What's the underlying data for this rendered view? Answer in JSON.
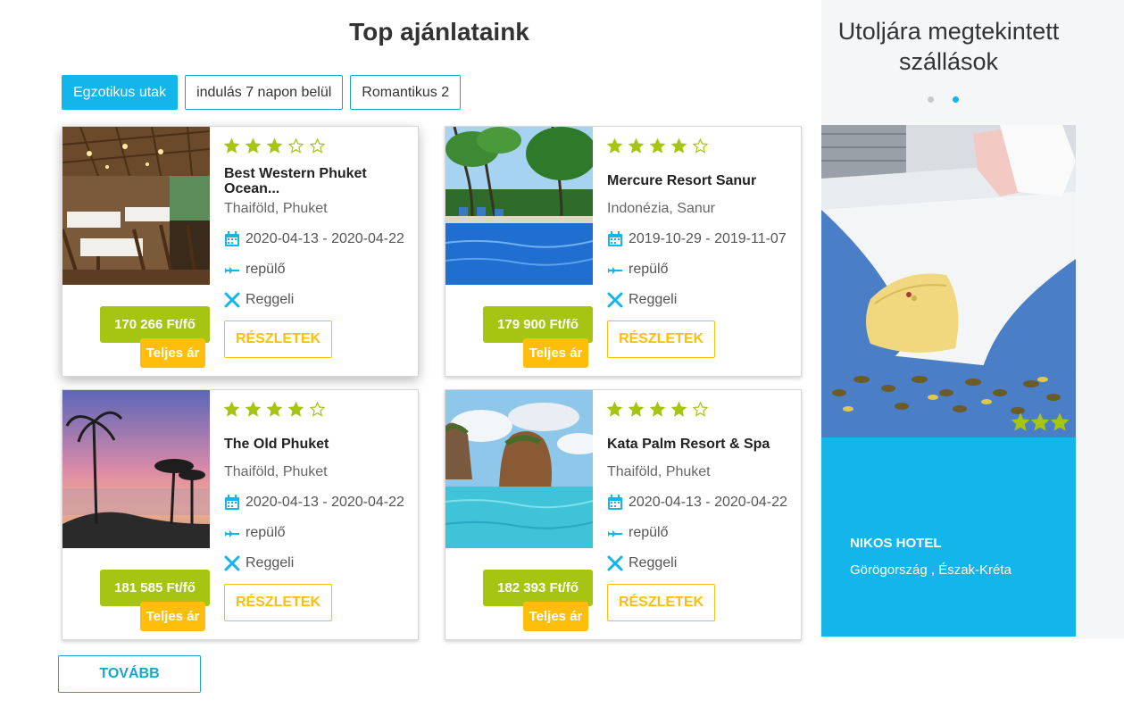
{
  "section_title": "Top ajánlataink",
  "filters": [
    {
      "label": "Egzotikus utak",
      "active": true
    },
    {
      "label": "indulás 7 napon belül",
      "active": false
    },
    {
      "label": "Romantikus 2",
      "active": false
    }
  ],
  "offers": [
    {
      "name": "Best Western Phuket Ocean...",
      "stars": 3,
      "location": "Thaiföld, Phuket",
      "dates": "2020-04-13 - 2020-04-22",
      "transport": "repülő",
      "board": "Reggeli",
      "price": "170 266 Ft/fő",
      "full_price_label": "Teljes ár",
      "details_label": "RÉSZLETEK",
      "image": "restaurant-photo"
    },
    {
      "name": "Mercure Resort Sanur",
      "stars": 4,
      "location": "Indonézia, Sanur",
      "dates": "2019-10-29 - 2019-11-07",
      "transport": "repülő",
      "board": "Reggeli",
      "price": "179 900 Ft/fő",
      "full_price_label": "Teljes ár",
      "details_label": "RÉSZLETEK",
      "image": "pool-palms-photo"
    },
    {
      "name": "The Old Phuket",
      "stars": 4,
      "location": "Thaiföld, Phuket",
      "dates": "2020-04-13 - 2020-04-22",
      "transport": "repülő",
      "board": "Reggeli",
      "price": "181 585 Ft/fő",
      "full_price_label": "Teljes ár",
      "details_label": "RÉSZLETEK",
      "image": "sunset-palms-photo"
    },
    {
      "name": "Kata Palm Resort & Spa",
      "stars": 4,
      "location": "Thaiföld, Phuket",
      "dates": "2020-04-13 - 2020-04-22",
      "transport": "repülő",
      "board": "Reggeli",
      "price": "182 393 Ft/fő",
      "full_price_label": "Teljes ár",
      "details_label": "RÉSZLETEK",
      "image": "rock-islands-photo"
    }
  ],
  "more_label": "TOVÁBB",
  "sidebar": {
    "title": "Utoljára megtekintett szállások",
    "active_dot": 1,
    "dot_count": 2,
    "recent": {
      "name": "NIKOS HOTEL",
      "location": "Görögország , Észak-Kréta",
      "stars": 3,
      "image": "bedroom-pillow-photo"
    }
  },
  "colors": {
    "accent": "#13b5ea",
    "price_green": "#a6c513",
    "gold": "#ffbe0b",
    "star_green": "#a6c513"
  }
}
